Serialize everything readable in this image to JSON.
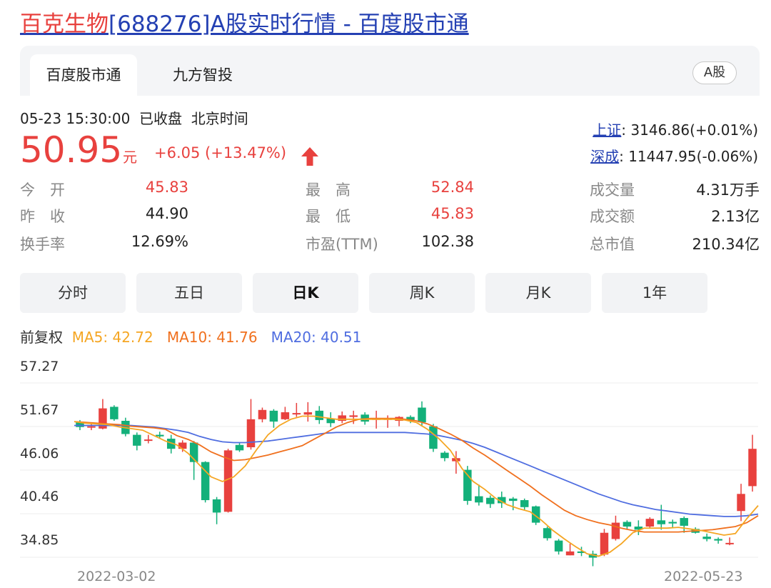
{
  "page_title": {
    "name_highlight": "百克生物",
    "rest": "[688276]A股实时行情 - 百度股市通"
  },
  "tabs": [
    {
      "label": "百度股市通",
      "active": true
    },
    {
      "label": "九方智投",
      "active": false
    }
  ],
  "market_badge": "A股",
  "status": {
    "time": "05-23 15:30:00",
    "state": "已收盘",
    "tz": "北京时间"
  },
  "quote": {
    "price": "50.95",
    "unit": "元",
    "change": "+6.05 (+13.47%)"
  },
  "indices": [
    {
      "name": "上证",
      "value": ": 3146.86(+0.01%)"
    },
    {
      "name": "深成",
      "value": ": 11447.95(-0.06%)"
    }
  ],
  "stats": {
    "open": {
      "label": "今　开",
      "value": "45.83"
    },
    "prev_close": {
      "label": "昨　收",
      "value": "44.90"
    },
    "turnover_rate": {
      "label": "换手率",
      "value": "12.69%"
    },
    "high": {
      "label": "最　高",
      "value": "52.84"
    },
    "low": {
      "label": "最　低",
      "value": "45.83"
    },
    "pe": {
      "label": "市盈(TTM)",
      "value": "102.38"
    },
    "volume": {
      "label": "成交量",
      "value": "4.31万手"
    },
    "amount": {
      "label": "成交额",
      "value": "2.13亿"
    },
    "market_cap": {
      "label": "总市值",
      "value": "210.34亿"
    }
  },
  "periods": [
    {
      "label": "分时",
      "active": false
    },
    {
      "label": "五日",
      "active": false
    },
    {
      "label": "日K",
      "active": true
    },
    {
      "label": "周K",
      "active": false
    },
    {
      "label": "月K",
      "active": false
    },
    {
      "label": "1年",
      "active": false
    }
  ],
  "ma_legend": {
    "adj": "前复权",
    "ma5": "MA5: 42.72",
    "ma10": "MA10: 41.76",
    "ma20": "MA20: 40.51"
  },
  "colors": {
    "up": "#e8413e",
    "down": "#13b07a",
    "ma5": "#f5a623",
    "ma10": "#f0701e",
    "ma20": "#4f6de0",
    "link": "#2440b3"
  },
  "chart_data": {
    "type": "candlestick",
    "yticks": [
      "57.27",
      "51.67",
      "46.06",
      "40.46",
      "34.85"
    ],
    "ylim": [
      34.85,
      57.27
    ],
    "x_start": "2022-03-02",
    "x_end": "2022-05-23",
    "candles": [
      [
        52.3,
        51.6,
        52.5,
        51.2
      ],
      [
        51.6,
        51.7,
        52.0,
        51.2
      ],
      [
        51.4,
        54.0,
        55.2,
        51.3
      ],
      [
        54.2,
        52.6,
        54.4,
        52.4
      ],
      [
        52.4,
        50.7,
        52.8,
        50.4
      ],
      [
        50.6,
        49.2,
        50.9,
        48.6
      ],
      [
        49.9,
        50.0,
        50.6,
        49.5
      ],
      [
        50.6,
        50.4,
        51.0,
        50.1
      ],
      [
        50.1,
        48.8,
        50.6,
        48.2
      ],
      [
        48.8,
        49.6,
        49.9,
        48.4
      ],
      [
        49.6,
        47.1,
        49.8,
        44.8
      ],
      [
        47.1,
        42.2,
        47.2,
        41.9
      ],
      [
        42.3,
        40.6,
        42.6,
        39.1
      ],
      [
        40.7,
        48.6,
        48.8,
        40.6
      ],
      [
        49.3,
        48.6,
        49.6,
        48.4
      ],
      [
        49.0,
        52.6,
        55.2,
        48.7
      ],
      [
        52.6,
        53.8,
        54.1,
        52.2
      ],
      [
        53.7,
        52.3,
        53.9,
        51.5
      ],
      [
        52.6,
        53.5,
        54.2,
        52.5
      ],
      [
        53.3,
        53.4,
        54.7,
        52.9
      ],
      [
        53.2,
        53.5,
        54.8,
        52.3
      ],
      [
        53.7,
        52.5,
        54.3,
        52.0
      ],
      [
        52.7,
        52.1,
        53.5,
        51.6
      ],
      [
        52.4,
        53.1,
        53.6,
        52.1
      ],
      [
        52.9,
        53.1,
        53.7,
        52.0
      ],
      [
        53.2,
        52.3,
        53.5,
        51.9
      ],
      [
        52.6,
        52.7,
        53.7,
        51.4
      ],
      [
        52.7,
        52.7,
        53.1,
        51.5
      ],
      [
        52.4,
        52.9,
        53.0,
        51.7
      ],
      [
        52.9,
        52.5,
        53.1,
        52.1
      ],
      [
        54.1,
        52.2,
        54.9,
        51.7
      ],
      [
        51.7,
        48.8,
        52.0,
        48.4
      ],
      [
        48.3,
        47.6,
        48.5,
        47.2
      ],
      [
        47.2,
        47.6,
        48.5,
        45.6
      ],
      [
        46.1,
        42.1,
        46.6,
        41.6
      ],
      [
        42.7,
        41.9,
        44.2,
        41.5
      ],
      [
        42.5,
        41.7,
        42.8,
        41.2
      ],
      [
        42.6,
        41.8,
        43.3,
        41.2
      ],
      [
        42.4,
        42.1,
        42.6,
        40.9
      ],
      [
        42.2,
        41.3,
        42.4,
        40.9
      ],
      [
        41.4,
        39.3,
        41.5,
        39.0
      ],
      [
        38.6,
        37.3,
        38.8,
        37.0
      ],
      [
        37.0,
        35.6,
        37.2,
        35.2
      ],
      [
        35.1,
        35.6,
        36.6,
        35.1
      ],
      [
        35.6,
        35.4,
        36.2,
        35.0
      ],
      [
        35.3,
        34.8,
        35.7,
        33.7
      ],
      [
        35.2,
        38.0,
        38.5,
        35.0
      ],
      [
        37.2,
        39.3,
        40.2,
        37.0
      ],
      [
        39.4,
        38.8,
        39.6,
        38.4
      ],
      [
        38.8,
        38.4,
        39.6,
        37.7
      ],
      [
        38.8,
        39.8,
        40.0,
        38.6
      ],
      [
        39.6,
        39.1,
        41.6,
        38.4
      ],
      [
        39.4,
        39.2,
        39.7,
        38.7
      ],
      [
        39.9,
        38.9,
        40.1,
        38.0
      ],
      [
        38.5,
        38.0,
        38.7,
        37.9
      ],
      [
        37.5,
        37.2,
        37.9,
        36.9
      ],
      [
        37.2,
        37.0,
        37.4,
        36.6
      ],
      [
        36.7,
        36.7,
        37.4,
        36.4
      ],
      [
        40.8,
        43.0,
        44.3,
        39.5
      ],
      [
        44.0,
        48.8,
        50.6,
        43.3
      ]
    ],
    "ma5": [
      52.3,
      52.1,
      52.0,
      51.9,
      51.6,
      51.4,
      51.2,
      50.5,
      49.8,
      49.3,
      48.2,
      46.7,
      45.2,
      44.6,
      45.2,
      46.6,
      48.7,
      50.6,
      51.8,
      52.6,
      53.0,
      53.0,
      52.8,
      52.6,
      52.6,
      52.6,
      52.6,
      52.6,
      52.6,
      52.5,
      52.2,
      51.3,
      50.1,
      48.6,
      46.3,
      44.6,
      43.6,
      42.4,
      41.6,
      41.1,
      40.7,
      39.6,
      38.3,
      37.2,
      36.2,
      35.3,
      35.0,
      35.5,
      36.6,
      38.0,
      38.6,
      38.6,
      38.6,
      38.7,
      38.5,
      38.3,
      38.0,
      37.7,
      37.9,
      39.8,
      41.5
    ],
    "ma10": [
      52.3,
      52.2,
      52.1,
      52.0,
      51.9,
      51.7,
      51.6,
      51.5,
      51.3,
      50.5,
      50.0,
      49.3,
      48.4,
      47.8,
      47.3,
      47.4,
      47.7,
      48.0,
      48.4,
      48.8,
      49.2,
      50.0,
      50.8,
      51.6,
      52.2,
      52.6,
      52.7,
      52.7,
      52.7,
      52.6,
      52.4,
      52.0,
      51.4,
      50.7,
      49.9,
      48.9,
      48.0,
      47.0,
      46.0,
      45.0,
      44.0,
      42.9,
      41.9,
      40.9,
      40.2,
      39.7,
      39.3,
      39.0,
      38.6,
      38.3,
      38.1,
      38.1,
      38.1,
      38.1,
      38.2,
      38.3,
      38.4,
      38.6,
      38.8,
      39.3,
      40.2
    ],
    "ma20": [
      51.8,
      51.8,
      51.8,
      51.8,
      51.8,
      51.8,
      51.7,
      51.6,
      51.4,
      51.2,
      50.9,
      50.4,
      50.0,
      49.7,
      49.6,
      49.6,
      49.7,
      49.8,
      50.0,
      50.2,
      50.4,
      50.6,
      50.8,
      50.9,
      50.9,
      50.9,
      50.9,
      50.9,
      50.9,
      50.9,
      50.8,
      50.7,
      50.5,
      50.2,
      49.9,
      49.5,
      49.0,
      48.4,
      47.8,
      47.2,
      46.6,
      46.0,
      45.4,
      44.8,
      44.2,
      43.6,
      43.0,
      42.5,
      42.0,
      41.6,
      41.3,
      41.0,
      40.8,
      40.6,
      40.4,
      40.3,
      40.2,
      40.1,
      40.1,
      40.2,
      40.4
    ]
  }
}
